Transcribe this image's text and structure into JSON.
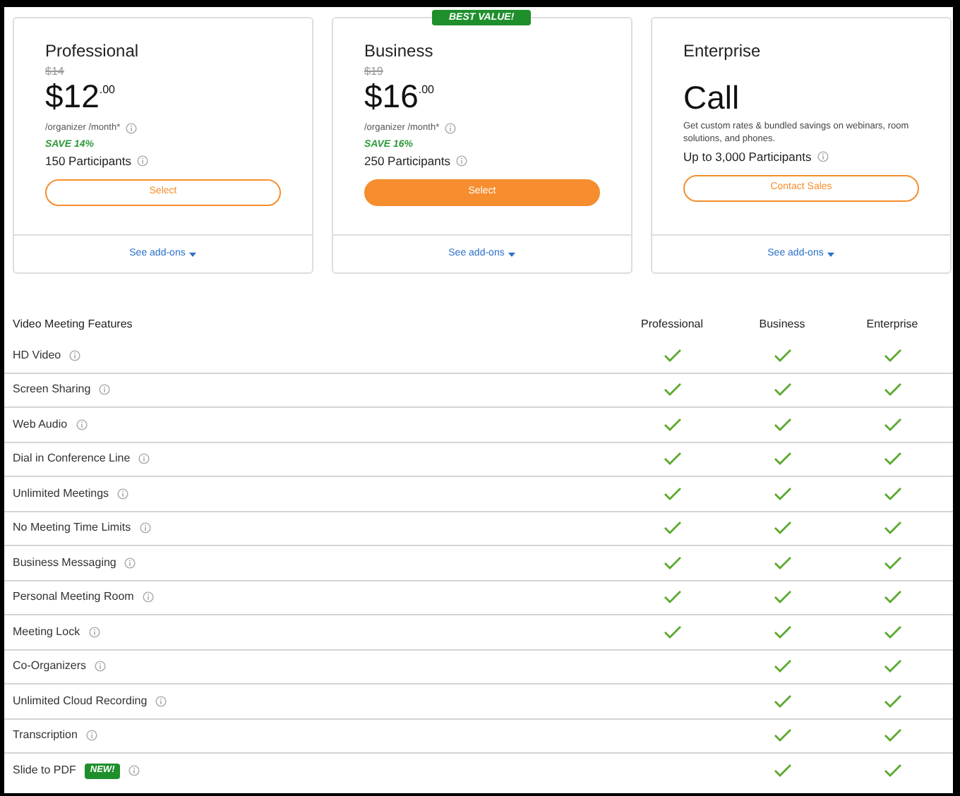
{
  "plans": [
    {
      "kind": "price",
      "name": "Professional",
      "old_price": "$14",
      "price": "$12",
      "cents": ".00",
      "unit": "/organizer /month*",
      "save": "SAVE 14%",
      "participants": "150 Participants",
      "button": {
        "label": "Select",
        "filled": false
      },
      "addons": "See add-ons"
    },
    {
      "kind": "price",
      "name": "Business",
      "ribbon": "BEST VALUE!",
      "old_price": "$19",
      "price": "$16",
      "cents": ".00",
      "unit": "/organizer /month*",
      "save": "SAVE 16%",
      "participants": "250 Participants",
      "button": {
        "label": "Select",
        "filled": true
      },
      "addons": "See add-ons"
    },
    {
      "kind": "call",
      "name": "Enterprise",
      "price": "Call",
      "description": "Get custom rates & bundled savings on webinars, room solutions, and phones.",
      "participants": "Up to 3,000 Participants",
      "button": {
        "label": "Contact Sales",
        "filled": false
      },
      "addons": "See add-ons"
    }
  ],
  "features": {
    "title": "Video Meeting Features",
    "columns": [
      "Professional",
      "Business",
      "Enterprise"
    ],
    "rows": [
      {
        "label": "HD Video",
        "checks": [
          true,
          true,
          true
        ]
      },
      {
        "label": "Screen Sharing",
        "checks": [
          true,
          true,
          true
        ]
      },
      {
        "label": "Web Audio",
        "checks": [
          true,
          true,
          true
        ]
      },
      {
        "label": "Dial in Conference Line",
        "checks": [
          true,
          true,
          true
        ]
      },
      {
        "label": "Unlimited Meetings",
        "checks": [
          true,
          true,
          true
        ]
      },
      {
        "label": "No Meeting Time Limits",
        "checks": [
          true,
          true,
          true
        ]
      },
      {
        "label": "Business Messaging",
        "checks": [
          true,
          true,
          true
        ]
      },
      {
        "label": "Personal Meeting Room",
        "checks": [
          true,
          true,
          true
        ]
      },
      {
        "label": "Meeting Lock",
        "checks": [
          true,
          true,
          true
        ]
      },
      {
        "label": "Co-Organizers",
        "checks": [
          false,
          true,
          true
        ]
      },
      {
        "label": "Unlimited Cloud Recording",
        "checks": [
          false,
          true,
          true
        ]
      },
      {
        "label": "Transcription",
        "checks": [
          false,
          true,
          true
        ]
      },
      {
        "label": "Slide to PDF",
        "badge": "NEW!",
        "checks": [
          false,
          true,
          true
        ]
      }
    ]
  }
}
